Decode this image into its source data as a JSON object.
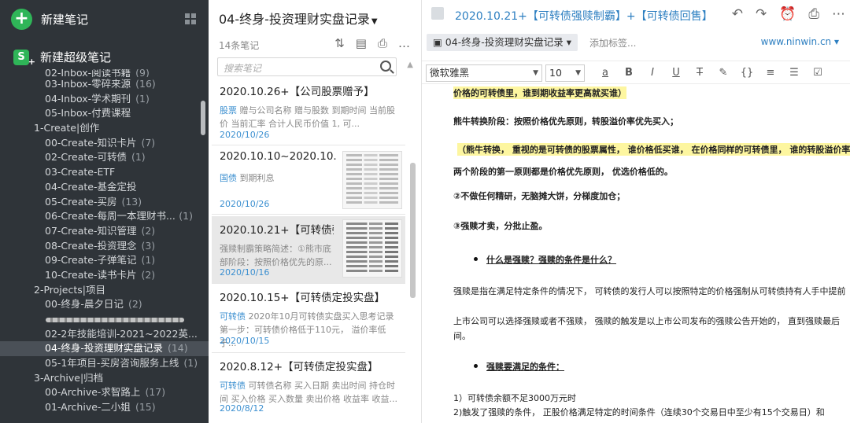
{
  "sidebar": {
    "new_note": "新建笔记",
    "new_super_note": "新建超级笔记",
    "super_icon_letter": "S",
    "tree": [
      {
        "label": "02-Inbox-阅读书籍",
        "count": "(9)",
        "level": 2,
        "cut": true
      },
      {
        "label": "03-Inbox-零碎来源",
        "count": "(16)",
        "level": 2
      },
      {
        "label": "04-Inbox-学术期刊",
        "count": "(1)",
        "level": 2
      },
      {
        "label": "05-Inbox-付费课程",
        "count": "",
        "level": 2
      },
      {
        "label": "1-Create|创作",
        "count": "",
        "level": 1
      },
      {
        "label": "00-Create-知识卡片",
        "count": "(7)",
        "level": 2
      },
      {
        "label": "02-Create-可转债",
        "count": "(1)",
        "level": 2
      },
      {
        "label": "03-Create-ETF",
        "count": "",
        "level": 2
      },
      {
        "label": "04-Create-基金定投",
        "count": "",
        "level": 2
      },
      {
        "label": "05-Create-买房",
        "count": "(13)",
        "level": 2
      },
      {
        "label": "06-Create-每周一本理财书...",
        "count": "(1)",
        "level": 2,
        "right": true
      },
      {
        "label": "07-Create-知识管理",
        "count": "(2)",
        "level": 2
      },
      {
        "label": "08-Create-投资理念",
        "count": "(3)",
        "level": 2
      },
      {
        "label": "09-Create-子弹笔记",
        "count": "(1)",
        "level": 2
      },
      {
        "label": "10-Create-读书卡片",
        "count": "(2)",
        "level": 2
      },
      {
        "label": "2-Projects|项目",
        "count": "",
        "level": 1
      },
      {
        "label": "00-终身-晨夕日记",
        "count": "(2)",
        "level": 2
      },
      {
        "label": "",
        "count": "",
        "level": 2,
        "blur": true
      },
      {
        "label": "02-2年技能培训-2021~2022英...",
        "count": "",
        "level": 2
      },
      {
        "label": "04-终身-投资理财实盘记录",
        "count": "(14)",
        "level": 2,
        "selected": true
      },
      {
        "label": "05-1年项目-买房咨询服务上线",
        "count": "(1)",
        "level": 2
      },
      {
        "label": "3-Archive|归档",
        "count": "",
        "level": 1
      },
      {
        "label": "00-Archive-求智路上",
        "count": "(17)",
        "level": 2
      },
      {
        "label": "01-Archive-二小姐",
        "count": "(15)",
        "level": 2
      }
    ]
  },
  "notelist": {
    "title": "04-终身-投资理财实盘记录",
    "count": "14条笔记",
    "search_placeholder": "搜索笔记",
    "cards": [
      {
        "title": "2020.10.26+【公司股票赠予】",
        "tag": "股票",
        "snippet1": " 赠与公司名称 赠与股数 到期时间 当前股",
        "snippet2": "价 当前汇率 合计人民币价值 1,          可...",
        "date": "2020/10/26",
        "thumb": false
      },
      {
        "title": "2020.10.10~2020.10.1...",
        "tag": "国债",
        "snippet1": " 到期利息",
        "snippet2": "",
        "date": "2020/10/26",
        "thumb": true
      },
      {
        "title": "2020.10.21+【可转债强...",
        "tag": "",
        "snippet1": "强赎制霸策略简述：①熊市底",
        "snippet2": "部阶段：按照价格优先的原...",
        "date": "2020/10/16",
        "thumb": true,
        "selected": true
      },
      {
        "title": "2020.10.15+【可转债定投实盘】",
        "tag": "可转债",
        "snippet1": " 2020年10月可转债实盘买入思考记录",
        "snippet2": "第一步：可转债价格低于110元，  溢价率低于...",
        "date": "2020/10/15",
        "thumb": false
      },
      {
        "title": "2020.8.12+【可转债定投实盘】",
        "tag": "可转债",
        "snippet1": " 可转债名称 买入日期 卖出时间 持仓时",
        "snippet2": "间 买入价格 买入数量 卖出价格 收益率 收益...",
        "date": "2020/8/12",
        "thumb": false
      }
    ]
  },
  "editor": {
    "title": "2020.10.21+【可转债强赎制霸】+【可转债回售】",
    "notebook": "04-终身-投资理财实盘记录",
    "add_tag": "添加标签...",
    "site": "www.ninwin.cn",
    "font": "微软雅黑",
    "size": "10",
    "fmt_buttons": [
      "a",
      "B",
      "I",
      "U",
      "T",
      "✎",
      "{}",
      "≡",
      "☰",
      "☑"
    ],
    "lines": {
      "l0": "价格的可转债里，谁到期收益率更高就买谁）",
      "l1": "熊牛转换阶段：按照价格优先原则，转股溢价率优先买入；",
      "l2": "（熊牛转换，  重视的是可转债的股票属性，  谁价格低买谁，  在价格同样的可转债里，  谁的转股溢价率",
      "l3": "两个阶段的第一原则都是价格优先原则，  优选价格低的。",
      "l4": "②不做任何精研，无脑摊大饼，分梯度加仓；",
      "l5": "③强赎才卖，分批止盈。",
      "l6": "什么是强赎？强赎的条件是什么？",
      "l7": "强赎是指在满足特定条件的情况下，  可转债的发行人可以按照特定的价格强制从可转债持有人手中提前",
      "l8": "上市公司可以选择强赎或者不强赎，  强赎的触发是以上市公司发布的强赎公告开始的，  直到强赎最后",
      "l9": "间。",
      "l10": "强赎要满足的条件：",
      "l11": "1）可转债余额不足3000万元时",
      "l12": "2)触发了强赎的条件，  正股价格满足特定的时间条件（连续30个交易日中至少有15个交易日）和"
    }
  },
  "colors": {
    "sidebar_bg": "#2f3439",
    "green": "#2fb558",
    "link_blue": "#2d7fc1",
    "highlight": "#fdf6a0"
  }
}
